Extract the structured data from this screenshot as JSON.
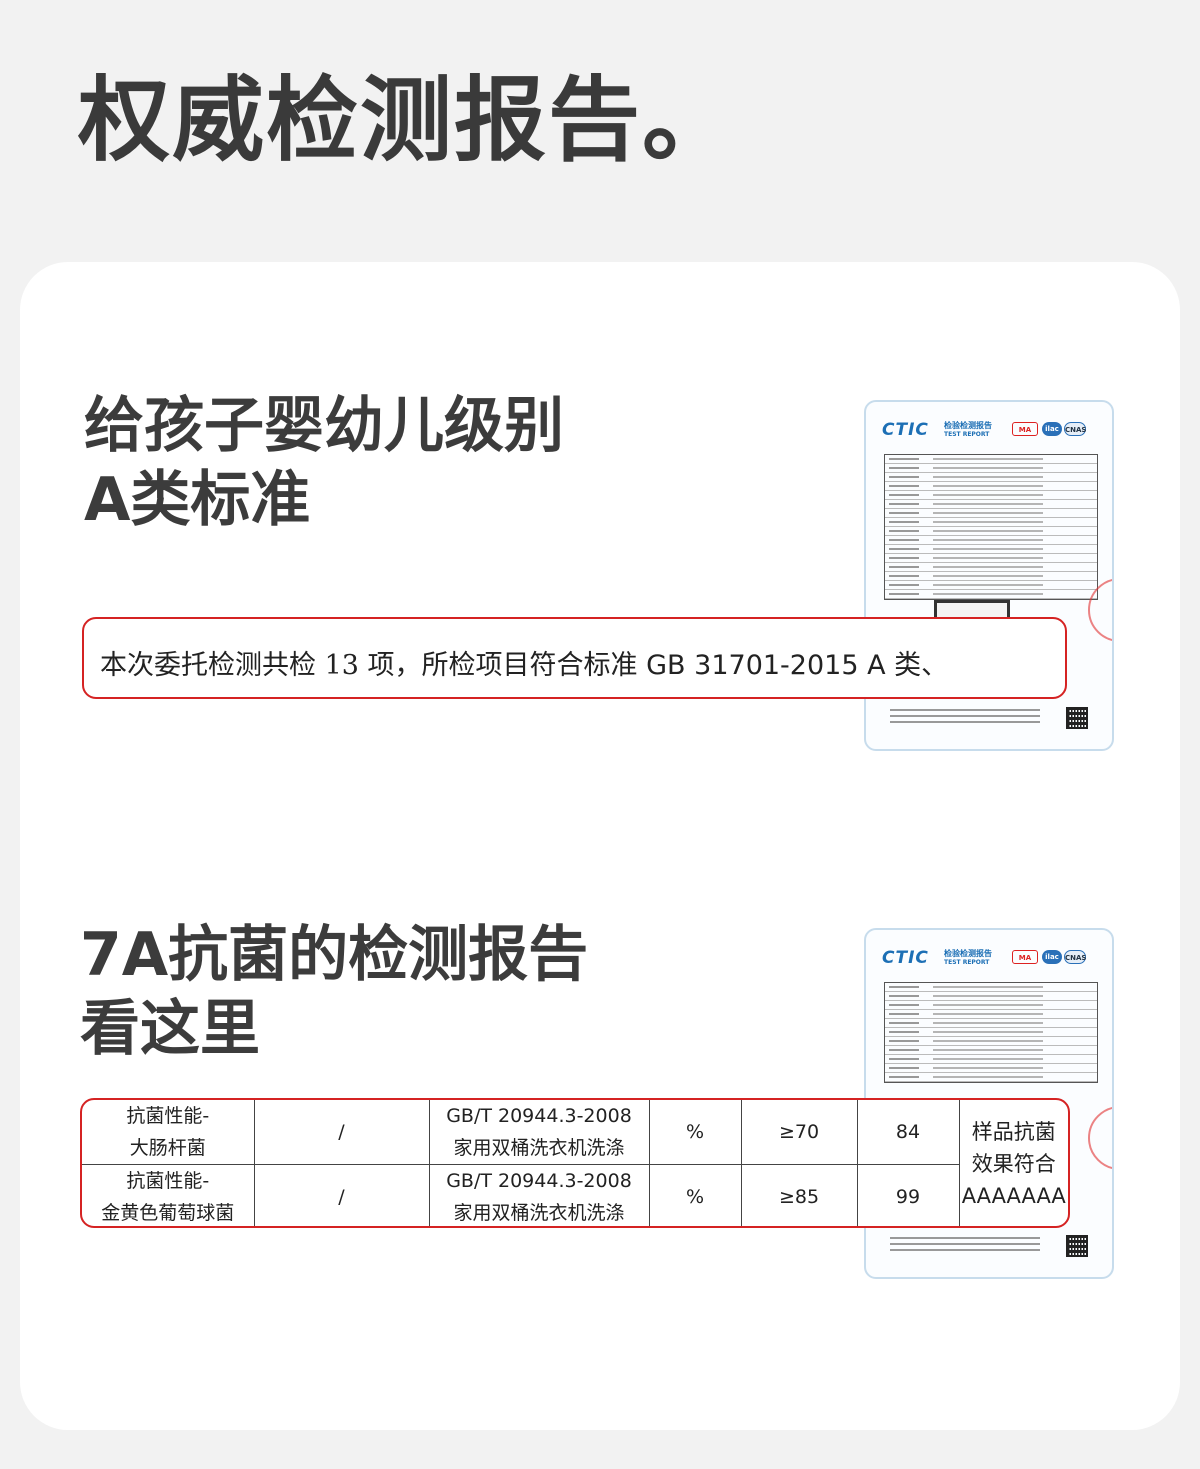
{
  "page": {
    "title": "权威检测报告。"
  },
  "section1": {
    "heading_line1": "给孩子婴幼儿级别",
    "heading_line2": "A类标准",
    "highlight_prefix": "本次委托检测共检 ",
    "highlight_count": "13",
    "highlight_mid": " 项，所检项目符合标准 ",
    "highlight_standard": "GB 31701-2015 A",
    "highlight_suffix": " 类、"
  },
  "section2": {
    "heading_line1": "7A抗菌的检测报告",
    "heading_line2": "看这里",
    "rows": [
      {
        "item_line1": "抗菌性能-",
        "item_line2": "大肠杆菌",
        "unit_col": "/",
        "method_line1": "GB/T 20944.3-2008",
        "method_line2": "家用双桶洗衣机洗涤",
        "unit": "%",
        "requirement": "≥70",
        "result": "84"
      },
      {
        "item_line1": "抗菌性能-",
        "item_line2": "金黄色葡萄球菌",
        "unit_col": "/",
        "method_line1": "GB/T 20944.3-2008",
        "method_line2": "家用双桶洗衣机洗涤",
        "unit": "%",
        "requirement": "≥85",
        "result": "99"
      }
    ],
    "conclusion_line1": "样品抗菌",
    "conclusion_line2": "效果符合",
    "conclusion_line3": "AAAAAAA"
  },
  "report_thumbnail": {
    "logo": "CTIC",
    "title_cn": "检验检测报告",
    "title_en": "TEST REPORT",
    "badge_ma": "MA",
    "badge_ilac": "ilac",
    "badge_cnas": "CNAS"
  },
  "icons": {
    "stamp": "red-seal-stamp",
    "qr": "qr-code"
  },
  "colors": {
    "highlight_border": "#d52323",
    "brand_blue": "#1c6fb5",
    "card_bg": "#ffffff",
    "page_bg": "#f2f2f2"
  }
}
